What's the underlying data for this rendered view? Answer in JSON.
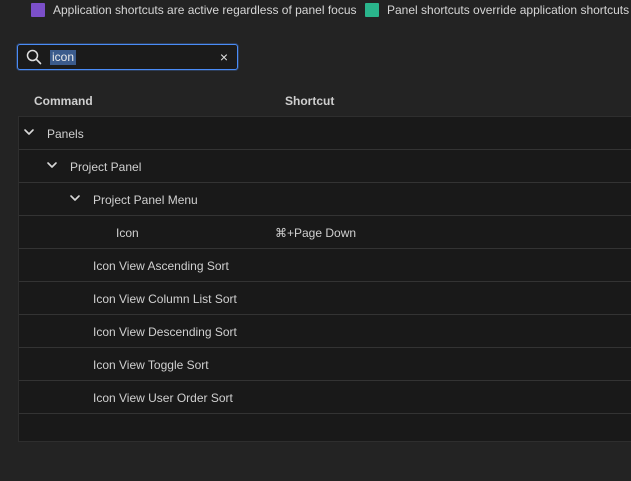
{
  "legend": {
    "items": [
      {
        "label": "Application shortcuts are active regardless of panel focus",
        "color": "#7b4fc9"
      },
      {
        "label": "Panel shortcuts override application shortcuts when",
        "color": "#2ab58c"
      }
    ]
  },
  "search": {
    "value": "icon",
    "clear_icon": "×",
    "accent": "#4a8cf7"
  },
  "columns": {
    "command": "Command",
    "shortcut": "Shortcut"
  },
  "rows": [
    {
      "label": "Panels",
      "expandable": true,
      "expanded": true,
      "depth": 0,
      "shortcut": ""
    },
    {
      "label": "Project Panel",
      "expandable": true,
      "expanded": true,
      "depth": 1,
      "shortcut": ""
    },
    {
      "label": "Project Panel Menu",
      "expandable": true,
      "expanded": true,
      "depth": 2,
      "shortcut": ""
    },
    {
      "label": "Icon",
      "expandable": false,
      "depth": 3,
      "shortcut": "⌘+Page Down"
    },
    {
      "label": "Icon View Ascending Sort",
      "expandable": false,
      "depth": 2,
      "shortcut": ""
    },
    {
      "label": "Icon View Column List Sort",
      "expandable": false,
      "depth": 2,
      "shortcut": ""
    },
    {
      "label": "Icon View Descending Sort",
      "expandable": false,
      "depth": 2,
      "shortcut": ""
    },
    {
      "label": "Icon View Toggle Sort",
      "expandable": false,
      "depth": 2,
      "shortcut": ""
    },
    {
      "label": "Icon View User Order Sort",
      "expandable": false,
      "depth": 2,
      "shortcut": ""
    }
  ]
}
